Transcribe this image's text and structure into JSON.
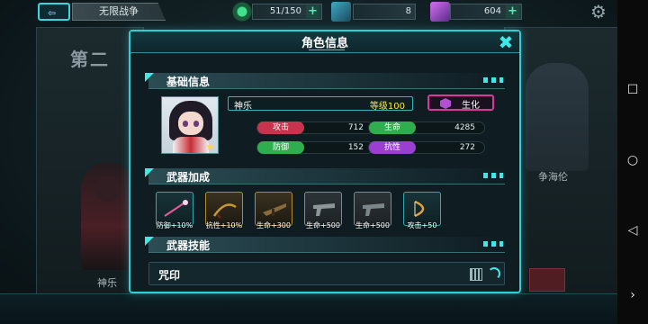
{
  "hud": {
    "back_label": "⇦",
    "mode_tab": "无限战争",
    "resources": [
      {
        "icon": "energy-icon",
        "value": "51/150",
        "color": "#40e08c"
      },
      {
        "icon": "crystal-icon",
        "value": "8",
        "color": "#3fa9c9"
      },
      {
        "icon": "gem-icon",
        "value": "604",
        "color": "#b25fe0"
      }
    ]
  },
  "background": {
    "stage_title": "第二",
    "char_left": "神乐",
    "char_right": "争海伦"
  },
  "modal": {
    "title": "角色信息",
    "close_icon": "close-icon",
    "sections": {
      "basic": "基础信息",
      "weapon_bonus": "武器加成",
      "weapon_skill": "武器技能"
    },
    "character": {
      "name": "神乐",
      "level": "等级100",
      "type": "生化",
      "type_color": "#d73a9a"
    },
    "stats": [
      {
        "label": "攻击",
        "value": "712",
        "color": "#c8344d"
      },
      {
        "label": "生命",
        "value": "4285",
        "color": "#2fae4f"
      },
      {
        "label": "防御",
        "value": "152",
        "color": "#2fae4f"
      },
      {
        "label": "抗性",
        "value": "272",
        "color": "#9a3fd0"
      }
    ],
    "weapons": [
      {
        "bonus": "防御+10%",
        "rarity": "teal"
      },
      {
        "bonus": "抗性+10%",
        "rarity": "gold"
      },
      {
        "bonus": "生命+300",
        "rarity": "gold"
      },
      {
        "bonus": "生命+500",
        "rarity": "silver"
      },
      {
        "bonus": "生命+500",
        "rarity": "silver"
      },
      {
        "bonus": "攻击+50",
        "rarity": "teal"
      }
    ],
    "skill": {
      "name": "咒印"
    }
  },
  "android_nav": {
    "square": "☐",
    "circle": "○",
    "back": "◁",
    "next": "›"
  }
}
